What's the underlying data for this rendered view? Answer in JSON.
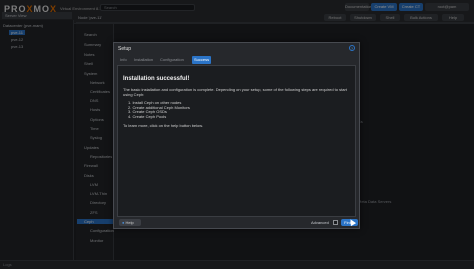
{
  "topbar": {
    "logo_a": "PRO",
    "logo_x": "X",
    "logo_b": "MO",
    "logo_x2": "X",
    "version": "Virtual Environment 8.1.4",
    "search_placeholder": "Search",
    "documentation": "Documentation",
    "create_vm": "Create VM",
    "create_ct": "Create CT",
    "user": "root@pam"
  },
  "tree": {
    "server_view": "Server View",
    "datacenter": "Datacenter (pve-mam)",
    "nodes": [
      "pve-11",
      "pve-12",
      "pve-13"
    ]
  },
  "node_header": {
    "title": "Node 'pve-11'",
    "reboot": "Reboot",
    "shutdown": "Shutdown",
    "shell": "Shell",
    "bulk_actions": "Bulk Actions",
    "help": "Help"
  },
  "nav": {
    "items": [
      "Search",
      "Summary",
      "Notes",
      "Shell",
      "System",
      "Network",
      "Certificates",
      "DNS",
      "Hosts",
      "Options",
      "Time",
      "Syslog",
      "Updates",
      "Repositories",
      "Firewall",
      "Disks",
      "LVM",
      "LVM-Thin",
      "Directory",
      "ZFS",
      "Ceph",
      "Configuration",
      "Monitor"
    ]
  },
  "main": {
    "osds_label": "PGs",
    "mds_label": "Meta Data Servers"
  },
  "statusbar": {
    "text": "Logs"
  },
  "dialog": {
    "title": "Setup",
    "help_icon": "?",
    "tabs": [
      "Info",
      "Installation",
      "Configuration",
      "Success"
    ],
    "heading": "Installation successful!",
    "intro": "The basic installation and configuration is complete. Depending on your setup, some of the following steps are required to start using Ceph:",
    "steps": [
      "1. Install Ceph on other nodes",
      "2. Create additional Ceph Monitors",
      "3. Create Ceph OSDs",
      "4. Create Ceph Pools"
    ],
    "outro": "To learn more, click on the help button below.",
    "help_button": "Help",
    "advanced_label": "Advanced",
    "finish_button": "Finish"
  },
  "colors": {
    "accent": "#2b74c7",
    "logo_x": "#e57000",
    "background": "#1f2125"
  }
}
